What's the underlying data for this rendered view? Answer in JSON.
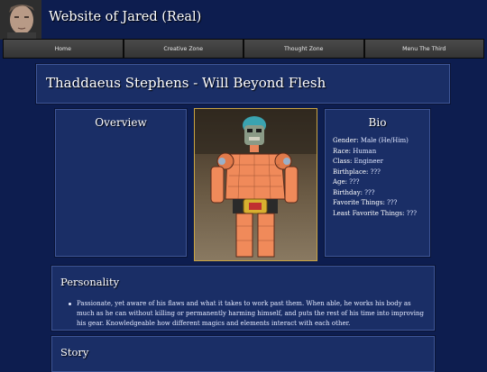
{
  "header": {
    "site_title": "Website of Jared (Real)"
  },
  "nav": {
    "items": [
      "Home",
      "Creative Zone",
      "Thought Zone",
      "Menu The Third"
    ]
  },
  "page": {
    "title": "Thaddaeus Stephens - Will Beyond Flesh"
  },
  "overview": {
    "heading": "Overview"
  },
  "bio": {
    "heading": "Bio",
    "fields": [
      {
        "key": "Gender:",
        "value": "Male (He/Him)"
      },
      {
        "key": "Race:",
        "value": "Human"
      },
      {
        "key": "Class:",
        "value": "Engineer"
      },
      {
        "key": "Birthplace:",
        "value": "???"
      },
      {
        "key": "Age:",
        "value": "???"
      },
      {
        "key": "Birthday:",
        "value": "???"
      },
      {
        "key": "Favorite Things:",
        "value": "???"
      },
      {
        "key": "Least Favorite Things:",
        "value": "???"
      }
    ]
  },
  "personality": {
    "heading": "Personality",
    "text": "Passionate, yet aware of his flaws and what it takes to work past them. When able, he works his body as much as he can without killing or permanently harming himself, and puts the rest of his time into improving his gear. Knowledgeable how different magics and elements interact with each other."
  },
  "story": {
    "heading": "Story"
  },
  "colors": {
    "background": "#0d1d4f",
    "panel": "#1a2e66",
    "panel_border": "#3e5596",
    "nav": "#3a3a3a"
  }
}
